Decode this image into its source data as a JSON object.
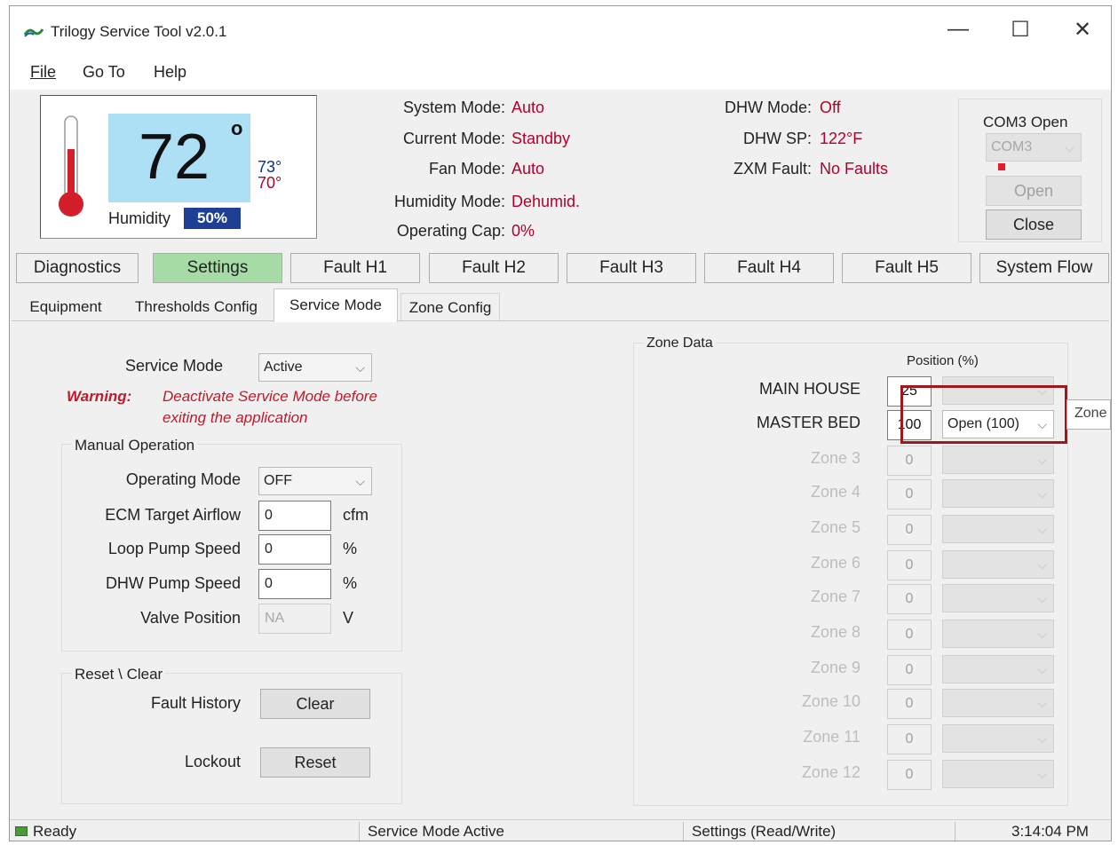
{
  "app": {
    "title": "Trilogy Service Tool  v2.0.1",
    "window_controls": {
      "minimize": "—",
      "maximize": "☐",
      "close": "✕"
    }
  },
  "menu": [
    "File",
    "Go To",
    "Help"
  ],
  "thermostat": {
    "temperature": "72",
    "degree": "o",
    "cool_setpoint": "73°",
    "heat_setpoint": "70°",
    "humidity_label": "Humidity",
    "humidity_value": "50%"
  },
  "status": {
    "system_mode_label": "System Mode:",
    "system_mode": "Auto",
    "current_mode_label": "Current Mode:",
    "current_mode": "Standby",
    "fan_mode_label": "Fan Mode:",
    "fan_mode": "Auto",
    "humidity_mode_label": "Humidity Mode:",
    "humidity_mode": "Dehumid.",
    "operating_cap_label": "Operating Cap:",
    "operating_cap": "0%",
    "dhw_mode_label": "DHW Mode:",
    "dhw_mode": "Off",
    "dhw_sp_label": "DHW SP:",
    "dhw_sp": "122°F",
    "zxm_fault_label": "ZXM Fault:",
    "zxm_fault": "No Faults"
  },
  "com": {
    "status": "COM3 Open",
    "port": "COM3",
    "open_button": "Open",
    "close_button": "Close"
  },
  "tabs": [
    "Diagnostics",
    "Settings",
    "Fault H1",
    "Fault H2",
    "Fault H3",
    "Fault H4",
    "Fault H5",
    "System Flow"
  ],
  "active_tab": "Settings",
  "subtabs": [
    "Equipment",
    "Thresholds Config",
    "Service Mode",
    "Zone Config"
  ],
  "active_subtab": "Service Mode",
  "service": {
    "label": "Service Mode",
    "value": "Active",
    "warning_label": "Warning:",
    "warning_line1": "Deactivate Service Mode before",
    "warning_line2": "exiting the application"
  },
  "manual": {
    "title": "Manual Operation",
    "operating_mode_label": "Operating Mode",
    "operating_mode": "OFF",
    "ecm_label": "ECM Target Airflow",
    "ecm_value": "0",
    "ecm_unit": "cfm",
    "loop_label": "Loop Pump Speed",
    "loop_value": "0",
    "loop_unit": "%",
    "dhw_label": "DHW Pump Speed",
    "dhw_value": "0",
    "dhw_unit": "%",
    "valve_label": "Valve Position",
    "valve_value": "NA",
    "valve_unit": "V"
  },
  "reset": {
    "title": "Reset \\ Clear",
    "fault_history_label": "Fault History",
    "clear_button": "Clear",
    "lockout_label": "Lockout",
    "reset_button": "Reset"
  },
  "zone_data": {
    "title": "Zone Data",
    "position_header": "Position (%)",
    "tooltip": "Zone",
    "zones": [
      {
        "name": "MAIN HOUSE",
        "position": "25",
        "select": "",
        "enabled": true
      },
      {
        "name": "MASTER BED",
        "position": "100",
        "select": "Open (100)",
        "enabled": true
      },
      {
        "name": "Zone 3",
        "position": "0",
        "select": "",
        "enabled": false
      },
      {
        "name": "Zone 4",
        "position": "0",
        "select": "",
        "enabled": false
      },
      {
        "name": "Zone 5",
        "position": "0",
        "select": "",
        "enabled": false
      },
      {
        "name": "Zone 6",
        "position": "0",
        "select": "",
        "enabled": false
      },
      {
        "name": "Zone 7",
        "position": "0",
        "select": "",
        "enabled": false
      },
      {
        "name": "Zone 8",
        "position": "0",
        "select": "",
        "enabled": false
      },
      {
        "name": "Zone 9",
        "position": "0",
        "select": "",
        "enabled": false
      },
      {
        "name": "Zone 10",
        "position": "0",
        "select": "",
        "enabled": false
      },
      {
        "name": "Zone 11",
        "position": "0",
        "select": "",
        "enabled": false
      },
      {
        "name": "Zone 12",
        "position": "0",
        "select": "",
        "enabled": false
      }
    ]
  },
  "statusbar": {
    "ready": "Ready",
    "service": "Service Mode Active",
    "settings": "Settings (Read/Write)",
    "time": "3:14:04 PM"
  },
  "colors": {
    "accent_red": "#b3002a",
    "setpoint_blue": "#0b2f8f",
    "active_tab_green": "#a6dba6",
    "highlight_box": "#a0181d",
    "temp_box_bg": "#aee0f5",
    "humidity_badge": "#1e3f93"
  }
}
